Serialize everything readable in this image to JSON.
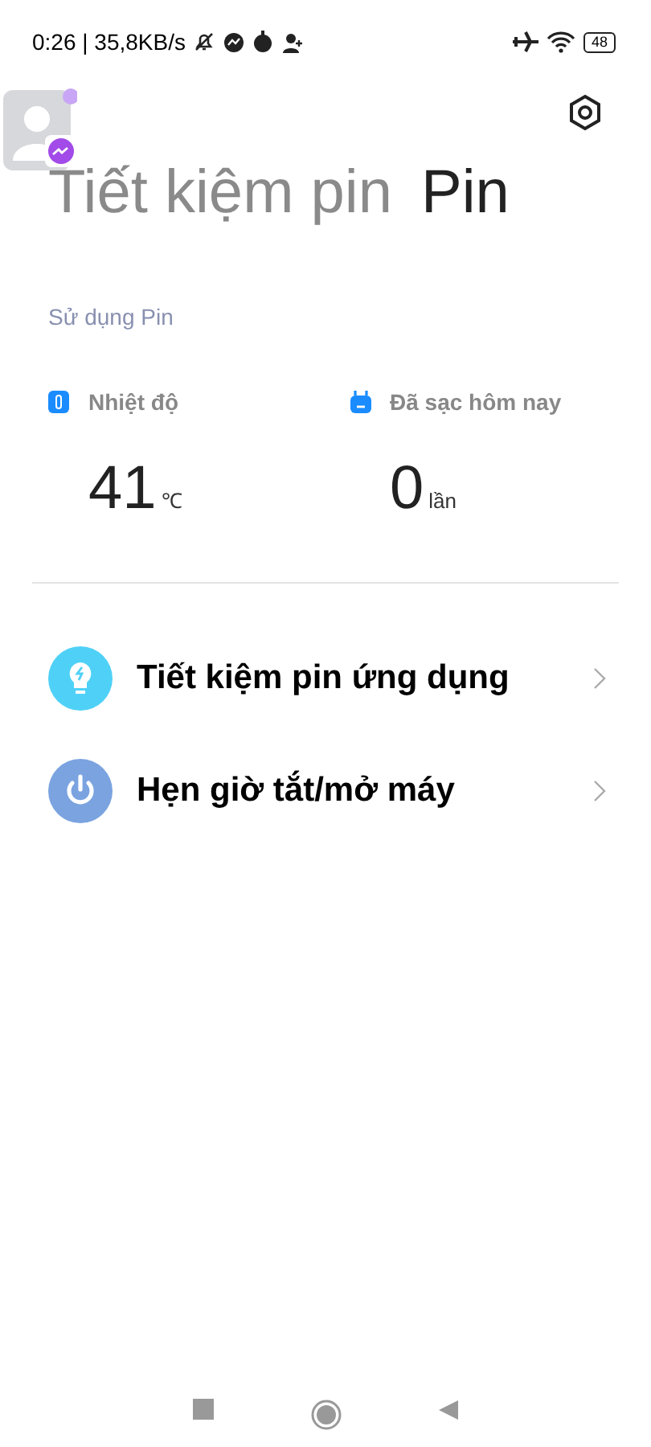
{
  "status_bar": {
    "time_speed": "0:26 | 35,8KB/s",
    "battery": "48"
  },
  "tabs": [
    {
      "label": "Tiết kiệm pin",
      "selected": false
    },
    {
      "label": "Pin",
      "selected": true
    }
  ],
  "section_title": "Sử dụng Pin",
  "stats": [
    {
      "kind": "temperature",
      "label": "Nhiệt độ",
      "value": "41",
      "unit": "℃"
    },
    {
      "kind": "charge",
      "label": "Đã sạc hôm nay",
      "value": "0",
      "unit": "lần"
    }
  ],
  "menu": [
    {
      "kind": "saver",
      "label": "Tiết kiệm pin ứng dụng"
    },
    {
      "kind": "power",
      "label": "Hẹn giờ tắt/mở máy"
    }
  ]
}
